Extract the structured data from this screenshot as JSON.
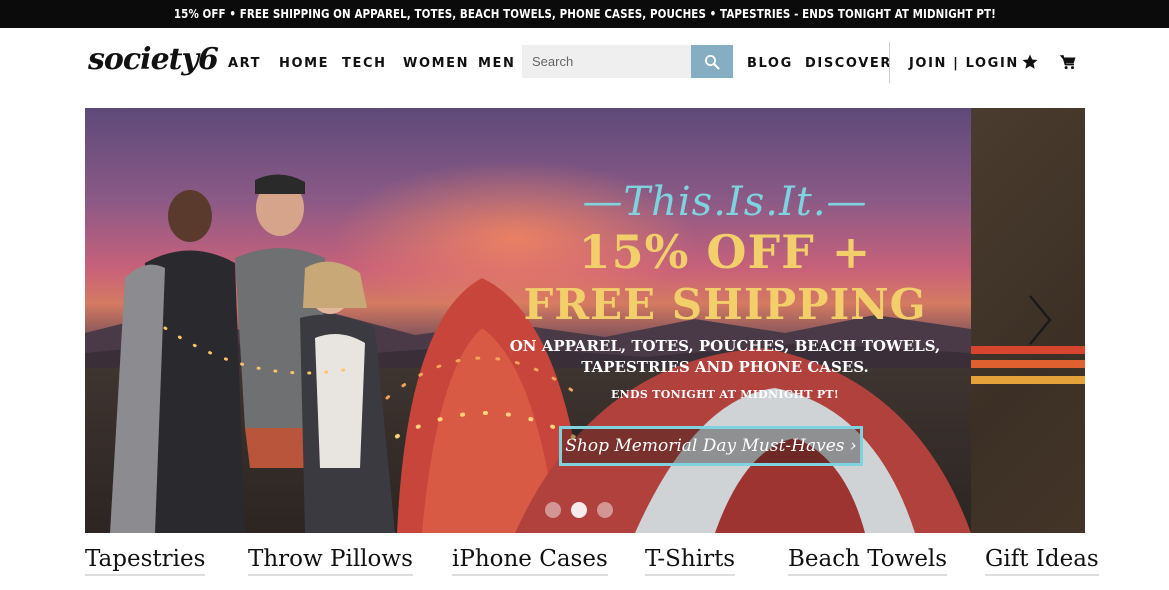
{
  "promo_bar": {
    "text": "15% OFF • FREE SHIPPING ON APPAREL, TOTES, BEACH TOWELS, PHONE CASES, POUCHES • TAPESTRIES - ENDS TONIGHT AT MIDNIGHT PT!"
  },
  "header": {
    "logo": "society6",
    "nav": [
      "ART",
      "HOME",
      "TECH",
      "WOMEN",
      "MEN"
    ],
    "search": {
      "placeholder": "Search",
      "value": ""
    },
    "nav_right": [
      "BLOG",
      "DISCOVER"
    ],
    "account": "JOIN | LOGIN",
    "icons": [
      "star-icon",
      "cart-icon",
      "search-icon"
    ]
  },
  "hero": {
    "tagline": "—This.Is.It.—",
    "headline_1": "15% OFF +",
    "headline_2": "FREE SHIPPING",
    "sub_line_1": "ON APPAREL, TOTES, POUCHES, BEACH TOWELS,",
    "sub_line_2": "TAPESTRIES AND PHONE CASES.",
    "ends": "ENDS TONIGHT AT MIDNIGHT PT!",
    "cta": "Shop Memorial Day Must-Haves ›",
    "slide_count": 3,
    "active_slide": 2
  },
  "categories": [
    "Tapestries",
    "Throw Pillows",
    "iPhone Cases",
    "T-Shirts",
    "Beach Towels",
    "Gift Ideas"
  ],
  "colors": {
    "promo_bg": "#0b0b0b",
    "search_button": "#86aec2",
    "headline": "#f2cf6a",
    "accent": "#7fd3df"
  }
}
